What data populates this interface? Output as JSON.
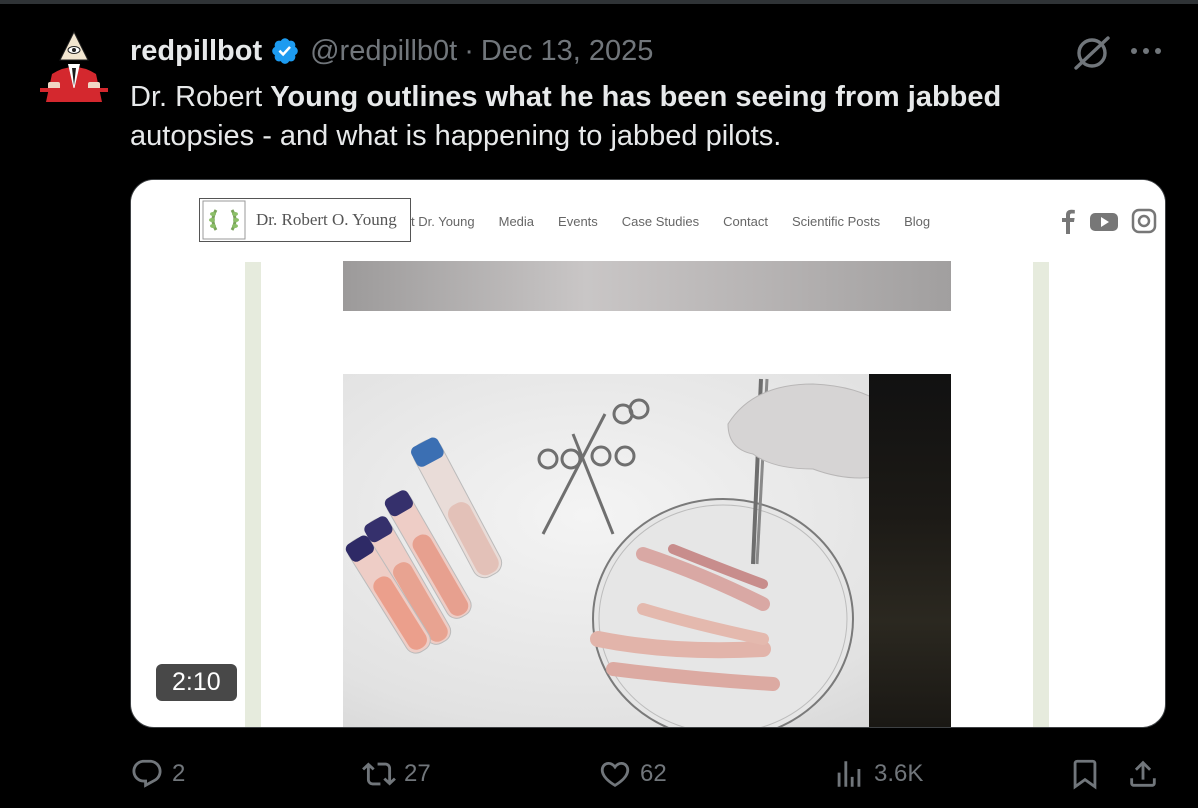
{
  "tweet": {
    "display_name": "redpillbot",
    "handle": "@redpillb0t",
    "separator": "·",
    "date": "Dec 13, 2025",
    "text_part1": "Dr. Robert ",
    "text_bold": "Young outlines what he has been seeing from jabbed",
    "text_part2": "autopsies - and what is happening to jabbed pilots."
  },
  "media": {
    "duration": "2:10",
    "site_logo_text": "Dr. Robert O. Young",
    "site_nav": [
      "t Dr. Young",
      "Media",
      "Events",
      "Case Studies",
      "Contact",
      "Scientific Posts",
      "Blog"
    ]
  },
  "actions": {
    "replies": "2",
    "reposts": "27",
    "likes": "62",
    "views": "3.6K"
  },
  "colors": {
    "background": "#000000",
    "text_primary": "#e7e9ea",
    "text_secondary": "#71767b",
    "verified": "#1d9bf0"
  },
  "icons": [
    "avatar",
    "verified-badge-icon",
    "grok-icon",
    "more-icon",
    "reply-icon",
    "repost-icon",
    "like-icon",
    "views-icon",
    "bookmark-icon",
    "share-icon",
    "facebook-icon",
    "youtube-icon",
    "instagram-icon",
    "laurel-icon"
  ]
}
